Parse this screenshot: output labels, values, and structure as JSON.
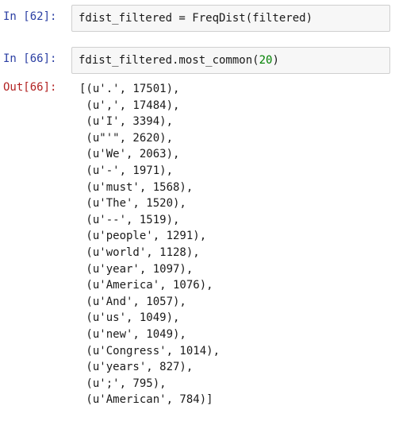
{
  "cells": [
    {
      "prompt": "In [62]:",
      "code": "fdist_filtered = FreqDist(filtered)"
    },
    {
      "prompt": "In [66]:",
      "code_before": "fdist_filtered.most_common(",
      "code_number": "20",
      "code_after": ")"
    }
  ],
  "output": {
    "prompt": "Out[66]:",
    "lines": [
      "[(u'.', 17501),",
      " (u',', 17484),",
      " (u'I', 3394),",
      " (u\"'\", 2620),",
      " (u'We', 2063),",
      " (u'-', 1971),",
      " (u'must', 1568),",
      " (u'The', 1520),",
      " (u'--', 1519),",
      " (u'people', 1291),",
      " (u'world', 1128),",
      " (u'year', 1097),",
      " (u'America', 1076),",
      " (u'And', 1057),",
      " (u'us', 1049),",
      " (u'new', 1049),",
      " (u'Congress', 1014),",
      " (u'years', 827),",
      " (u';', 795),",
      " (u'American', 784)]"
    ]
  },
  "colors": {
    "in_prompt": "#2b3fa3",
    "out_prompt": "#b22222",
    "number_literal": "#008000",
    "input_background": "#f7f7f7",
    "input_border": "#cfcfcf"
  }
}
